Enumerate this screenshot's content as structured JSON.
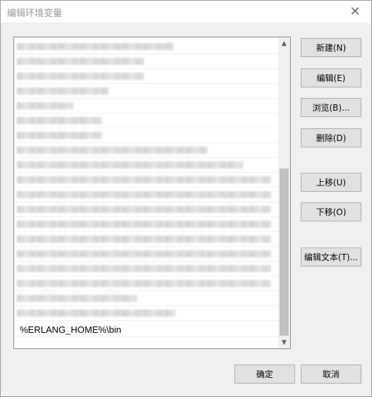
{
  "window": {
    "title": "编辑环境变量",
    "close_glyph": "✕"
  },
  "list": {
    "visible_entry": "%ERLANG_HOME%\\bin",
    "redacted_rows": 19
  },
  "side_buttons": {
    "new": "新建(N)",
    "edit": "编辑(E)",
    "browse": "浏览(B)...",
    "delete": "删除(D)",
    "move_up": "上移(U)",
    "move_down": "下移(O)",
    "edit_text": "编辑文本(T)..."
  },
  "footer_buttons": {
    "ok": "确定",
    "cancel": "取消"
  },
  "scrollbar": {
    "up_glyph": "▲",
    "down_glyph": "▼"
  }
}
